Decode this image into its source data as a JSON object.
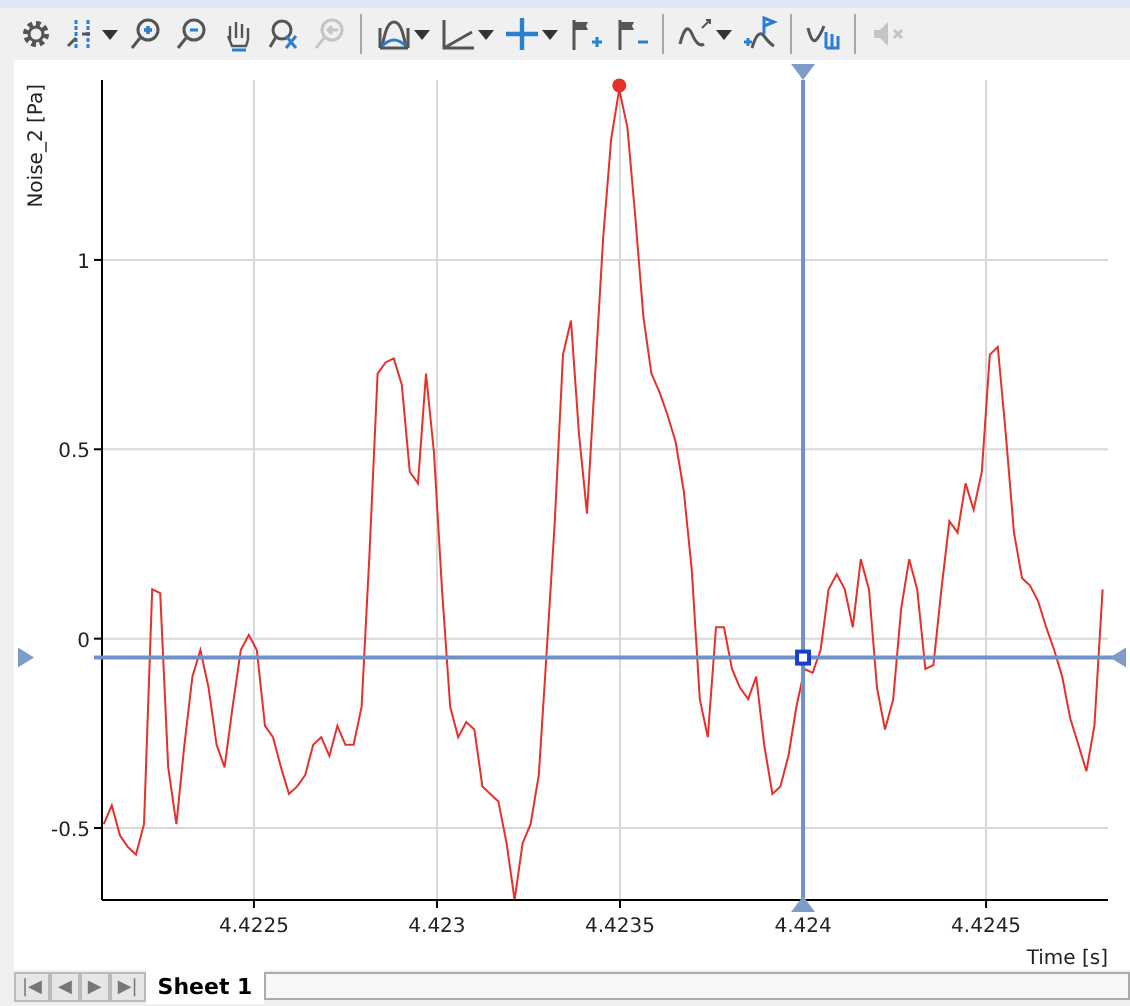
{
  "toolbar": [
    {
      "kind": "settings",
      "dropdown": false,
      "disabled": false,
      "separator_after": false
    },
    {
      "kind": "cursor-lines",
      "dropdown": true,
      "disabled": false,
      "separator_after": false
    },
    {
      "kind": "zoom-in",
      "dropdown": false,
      "disabled": false,
      "separator_after": false
    },
    {
      "kind": "zoom-out",
      "dropdown": false,
      "disabled": false,
      "separator_after": false
    },
    {
      "kind": "pan",
      "dropdown": false,
      "disabled": false,
      "separator_after": false
    },
    {
      "kind": "zoom-reset",
      "dropdown": false,
      "disabled": false,
      "separator_after": false
    },
    {
      "kind": "zoom-back",
      "dropdown": false,
      "disabled": true,
      "separator_after": true
    },
    {
      "kind": "bell",
      "dropdown": true,
      "disabled": false,
      "separator_after": false
    },
    {
      "kind": "axes",
      "dropdown": true,
      "disabled": false,
      "separator_after": false
    },
    {
      "kind": "crosshair",
      "dropdown": true,
      "disabled": false,
      "separator_after": false
    },
    {
      "kind": "flag-add",
      "dropdown": false,
      "disabled": false,
      "separator_after": false
    },
    {
      "kind": "flag-remove",
      "dropdown": false,
      "disabled": false,
      "separator_after": true
    },
    {
      "kind": "wave-arrows",
      "dropdown": true,
      "disabled": false,
      "separator_after": false
    },
    {
      "kind": "wave-flag",
      "dropdown": false,
      "disabled": false,
      "separator_after": true
    },
    {
      "kind": "wave-hand",
      "dropdown": false,
      "disabled": false,
      "separator_after": true
    },
    {
      "kind": "mute",
      "dropdown": false,
      "disabled": true,
      "separator_after": false
    }
  ],
  "chart": {
    "chart_data": {
      "type": "line",
      "grid": true,
      "xlabel": "Time [s]",
      "ylabel": "Noise_2 [Pa]",
      "xlim": [
        4.422085,
        4.424833
      ],
      "ylim": [
        -0.69,
        1.475
      ],
      "xticks": [
        {
          "value": 4.4225,
          "label": "4.4225"
        },
        {
          "value": 4.423,
          "label": "4.423"
        },
        {
          "value": 4.4235,
          "label": "4.4235"
        },
        {
          "value": 4.424,
          "label": "4.424"
        },
        {
          "value": 4.4245,
          "label": "4.4245"
        }
      ],
      "yticks": [
        {
          "value": -0.5,
          "label": "-0.5"
        },
        {
          "value": 0,
          "label": "0"
        },
        {
          "value": 0.5,
          "label": "0.5"
        },
        {
          "value": 1,
          "label": "1"
        }
      ],
      "x": [
        4.42209,
        4.422112,
        4.422134,
        4.422156,
        4.422178,
        4.4222,
        4.422222,
        4.422244,
        4.422266,
        4.422288,
        4.42231,
        4.422332,
        4.422354,
        4.422376,
        4.422398,
        4.42242,
        4.422442,
        4.422464,
        4.422486,
        4.422508,
        4.42253,
        4.422552,
        4.422574,
        4.422596,
        4.422618,
        4.42264,
        4.422662,
        4.422684,
        4.422706,
        4.422728,
        4.42275,
        4.422772,
        4.422794,
        4.422816,
        4.422838,
        4.42286,
        4.422882,
        4.422904,
        4.422926,
        4.422948,
        4.42297,
        4.422992,
        4.423014,
        4.423036,
        4.423058,
        4.42308,
        4.423102,
        4.423124,
        4.423146,
        4.423168,
        4.42319,
        4.423212,
        4.423234,
        4.423256,
        4.423278,
        4.4233,
        4.423322,
        4.423344,
        4.423366,
        4.423388,
        4.42341,
        4.423432,
        4.423454,
        4.423476,
        4.423498,
        4.42352,
        4.423542,
        4.423564,
        4.423586,
        4.423608,
        4.42363,
        4.423652,
        4.423674,
        4.423696,
        4.423718,
        4.42374,
        4.423762,
        4.423784,
        4.423806,
        4.423828,
        4.42385,
        4.423872,
        4.423894,
        4.423916,
        4.423938,
        4.42396,
        4.423982,
        4.424004,
        4.424026,
        4.424048,
        4.42407,
        4.424092,
        4.424114,
        4.424136,
        4.424158,
        4.42418,
        4.424202,
        4.424224,
        4.424246,
        4.424268,
        4.42429,
        4.424312,
        4.424334,
        4.424356,
        4.424378,
        4.4244,
        4.424422,
        4.424444,
        4.424466,
        4.424488,
        4.42451,
        4.424532,
        4.424554,
        4.424576,
        4.424598,
        4.42462,
        4.424642,
        4.424664,
        4.424686,
        4.424708,
        4.42473,
        4.424752,
        4.424774,
        4.424796,
        4.424818
      ],
      "series": [
        {
          "color": "#e8302a",
          "values": [
            -0.49,
            -0.44,
            -0.52,
            -0.55,
            -0.57,
            -0.49,
            0.13,
            0.12,
            -0.34,
            -0.49,
            -0.28,
            -0.1,
            -0.03,
            -0.13,
            -0.28,
            -0.34,
            -0.18,
            -0.03,
            0.01,
            -0.03,
            -0.23,
            -0.26,
            -0.34,
            -0.41,
            -0.39,
            -0.36,
            -0.28,
            -0.26,
            -0.31,
            -0.23,
            -0.28,
            -0.28,
            -0.18,
            0.23,
            0.7,
            0.73,
            0.74,
            0.67,
            0.44,
            0.41,
            0.7,
            0.49,
            0.13,
            -0.18,
            -0.26,
            -0.22,
            -0.24,
            -0.39,
            -0.41,
            -0.43,
            -0.54,
            -0.69,
            -0.54,
            -0.49,
            -0.36,
            -0.03,
            0.31,
            0.75,
            0.84,
            0.54,
            0.33,
            0.7,
            1.06,
            1.32,
            1.45,
            1.35,
            1.11,
            0.85,
            0.7,
            0.65,
            0.59,
            0.52,
            0.39,
            0.18,
            -0.16,
            -0.26,
            0.03,
            0.03,
            -0.08,
            -0.13,
            -0.16,
            -0.1,
            -0.28,
            -0.41,
            -0.39,
            -0.31,
            -0.18,
            -0.08,
            -0.09,
            -0.03,
            0.13,
            0.17,
            0.13,
            0.03,
            0.21,
            0.13,
            -0.13,
            -0.24,
            -0.16,
            0.08,
            0.21,
            0.13,
            -0.08,
            -0.07,
            0.13,
            0.31,
            0.28,
            0.41,
            0.34,
            0.44,
            0.75,
            0.77,
            0.54,
            0.28,
            0.16,
            0.14,
            0.1,
            0.03,
            -0.03,
            -0.1,
            -0.21,
            -0.28,
            -0.35,
            -0.23,
            0.13
          ]
        }
      ],
      "ref_lines": [
        {
          "axis": "x",
          "value": 4.424
        },
        {
          "axis": "y",
          "value": -0.05
        }
      ]
    }
  },
  "sheet_bar": {
    "nav": [
      "|◀",
      "◀",
      "▶",
      "▶|"
    ],
    "tabs": [
      {
        "label": "Sheet 1",
        "selected": true
      }
    ]
  }
}
